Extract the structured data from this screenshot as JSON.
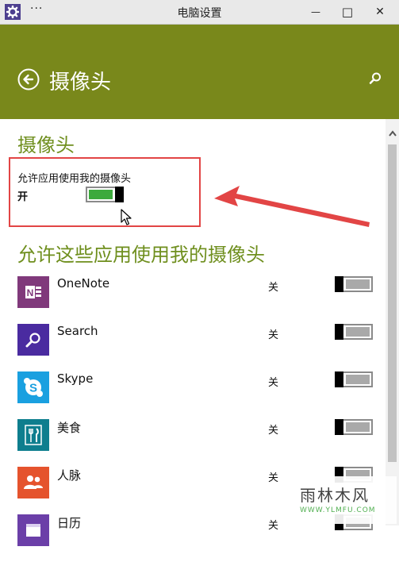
{
  "window": {
    "title": "电脑设置",
    "menu_glyph": "···",
    "minimize_glyph": "—",
    "maximize_glyph": "□",
    "close_glyph": "✕",
    "icon": "gear-icon"
  },
  "header": {
    "title": "摄像头",
    "back_icon": "back-arrow-icon",
    "search_icon": "search-icon",
    "background": "#79881b"
  },
  "camera_section": {
    "title": "摄像头",
    "allow_label": "允许应用使用我的摄像头",
    "state_label": "开",
    "enabled": true,
    "accent": "#3daa3d"
  },
  "apps_section": {
    "title": "允许这些应用使用我的摄像头",
    "apps": [
      {
        "name": "OneNote",
        "state": "关",
        "enabled": false,
        "icon": "onenote-icon",
        "color": "#80397b"
      },
      {
        "name": "Search",
        "state": "关",
        "enabled": false,
        "icon": "search-icon",
        "color": "#4a2ba0"
      },
      {
        "name": "Skype",
        "state": "关",
        "enabled": false,
        "icon": "skype-icon",
        "color": "#1aa0e0"
      },
      {
        "name": "美食",
        "state": "关",
        "enabled": false,
        "icon": "fork-knife-icon",
        "color": "#0e7e8e"
      },
      {
        "name": "人脉",
        "state": "关",
        "enabled": false,
        "icon": "people-icon",
        "color": "#e5532d"
      },
      {
        "name": "日历",
        "state": "关",
        "enabled": false,
        "icon": "calendar-icon",
        "color": "#6b3fa8"
      }
    ]
  },
  "watermark": {
    "title": "雨林木风",
    "url": "WWW.YLMFU.COM"
  }
}
